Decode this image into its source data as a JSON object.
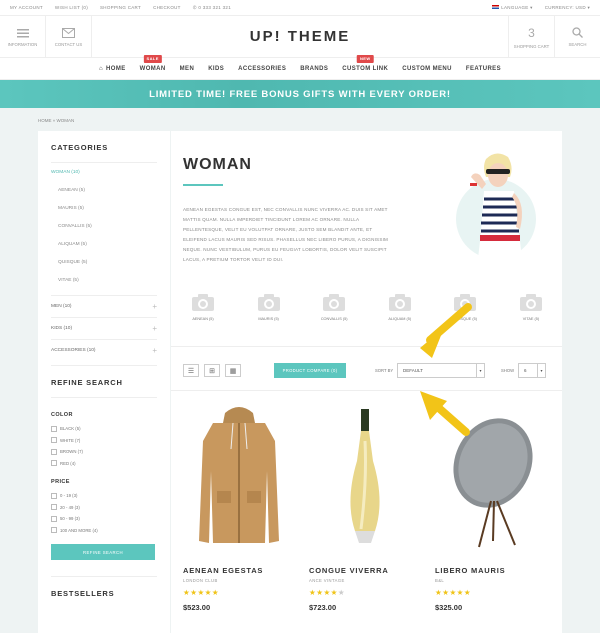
{
  "topbar": {
    "links": [
      "MY ACCOUNT",
      "WISH LIST (0)",
      "SHOPPING CART",
      "CHECKOUT"
    ],
    "phone": "0 333 321 321",
    "language": "LANGUAGE",
    "currency": "CURRENCY: USD"
  },
  "header": {
    "logo": "UP! THEME",
    "information": "INFORMATION",
    "contact": "CONTACT US",
    "cart_count": "3",
    "cart_label": "SHOPPING CART",
    "search_label": "SEARCH"
  },
  "nav": {
    "items": [
      "HOME",
      "WOMAN",
      "MEN",
      "KIDS",
      "ACCESSORIES",
      "BRANDS",
      "CUSTOM LINK",
      "CUSTOM MENU",
      "FEATURES"
    ],
    "badges": {
      "woman": "SALE",
      "custom_link": "NEW"
    }
  },
  "promo": "LIMITED TIME! FREE BONUS GIFTS WITH EVERY ORDER!",
  "breadcrumb": {
    "home": "HOME",
    "sep": "»",
    "current": "WOMAN"
  },
  "sidebar": {
    "categories_title": "CATEGORIES",
    "active": "WOMAN (10)",
    "subs": [
      "AENEAN (5)",
      "MAURIS (5)",
      "CONVALLIS (5)",
      "ALIQUAM (5)",
      "QUISQUE (5)",
      "VITAE (5)"
    ],
    "others": [
      "MEN (10)",
      "KIDS (10)",
      "ACCESSORIES (10)"
    ],
    "refine_title": "REFINE SEARCH",
    "color_title": "COLOR",
    "colors": [
      "BLACK (5)",
      "WHITE (7)",
      "BROWN (7)",
      "RED (4)"
    ],
    "price_title": "PRICE",
    "prices": [
      "0 - 19 (3)",
      "20 - 49 (3)",
      "50 - 99 (3)",
      "100 AND MORE (4)"
    ],
    "refine_button": "REFINE SEARCH",
    "bestsellers_title": "BESTSELLERS"
  },
  "main": {
    "title": "WOMAN",
    "description": "AENEAN EGESTAS CONGUE EST, NEC CONVALLIS NUNC VIVERRA AC. DUIS SIT AMET MATTIS QUAM. NULLA IMPERDIET TINCIDUNT LOREM AC ORNARE. NULLA PELLENTESQUE, VELIT EU VOLUTPAT ORNARE, JUSTO SEM BLANDIT ANTE, ET ELEIFEND LACUS MAURIS SED RISUS. PHASELLUS NEC LIBERO PURUS, A DIGNISSIM NEQUE. NUNC VESTIBULUM, PURUS EU FEUGIAT LOBORTIS, DOLOR VELIT SUSCIPIT LACUS, A PRETIUM TORTOR VELIT ID DUI.",
    "subcategories": [
      "AENEAN (5)",
      "MAURIS (5)",
      "CONVALLIS (5)",
      "ALIQUAM (5)",
      "QUISQUE (5)",
      "VITAE (5)"
    ],
    "compare_button": "PRODUCT COMPARE (0)",
    "sort_label": "SORT BY",
    "sort_value": "DEFAULT",
    "show_label": "SHOW",
    "show_value": "6"
  },
  "products": [
    {
      "name": "AENEAN EGESTAS",
      "brand": "LONDON CLUB",
      "price": "$523.00",
      "rating": 5
    },
    {
      "name": "CONGUE VIVERRA",
      "brand": "ANCE VINTAGE",
      "price": "$723.00",
      "rating": 4
    },
    {
      "name": "LIBERO MAURIS",
      "brand": "B&L",
      "price": "$325.00",
      "rating": 5
    }
  ],
  "colors": {
    "accent": "#5cc6be",
    "badge": "#e0494a",
    "star": "#f0c419",
    "arrow": "#f2c418"
  }
}
